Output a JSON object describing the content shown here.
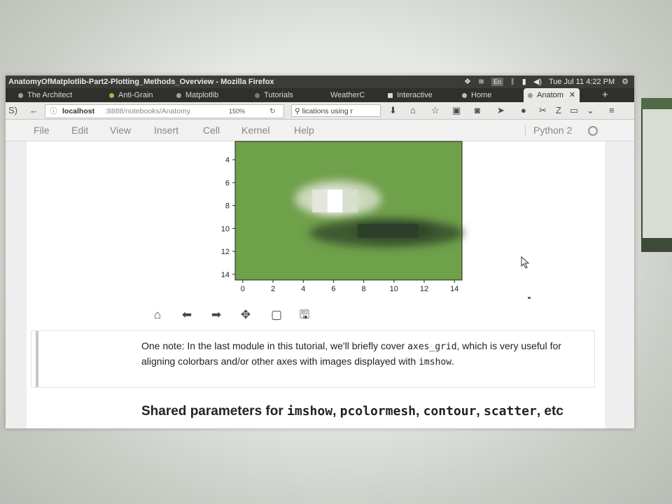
{
  "window": {
    "title": "AnatomyOfMatplotlib-Part2-Plotting_Methods_Overview - Mozilla Firefox",
    "tray_lang": "En",
    "datetime": "Tue Jul 11 4:22 PM"
  },
  "tabs": [
    {
      "label": "The Architect"
    },
    {
      "label": "Anti-Grain"
    },
    {
      "label": "Matplotlib"
    },
    {
      "label": "Tutorials"
    },
    {
      "label": "WeatherC"
    },
    {
      "label": "Interactive"
    },
    {
      "label": "Home"
    },
    {
      "label": "Anatom",
      "active": true
    }
  ],
  "navbar": {
    "url_host": "localhost",
    "url_path": ":8888/notebooks/Anatomy",
    "zoom": "150%",
    "search_value": "lications using r"
  },
  "jupyter_menu": [
    "File",
    "Edit",
    "View",
    "Insert",
    "Cell",
    "Kernel",
    "Help"
  ],
  "kernel": "Python 2",
  "plot": {
    "y_ticks": [
      "4",
      "6",
      "8",
      "10",
      "12",
      "14"
    ],
    "x_ticks": [
      "0",
      "2",
      "4",
      "6",
      "8",
      "10",
      "12",
      "14"
    ],
    "background_color": "#6fa04a"
  },
  "mpl_toolbar": [
    "home-icon",
    "back-arrow-icon",
    "forward-arrow-icon",
    "pan-icon",
    "zoom-rect-icon",
    "save-icon"
  ],
  "markdown": {
    "part1": "One note: In the last module in this tutorial, we'll briefly cover ",
    "code1": "axes_grid",
    "part2": ", which is very useful for aligning colorbars and/or other axes with images displayed with ",
    "code2": "imshow",
    "part3": "."
  },
  "heading": {
    "prefix": "Shared parameters for ",
    "code1": "imshow",
    "sep1": ", ",
    "code2": "pcolormesh",
    "sep2": ", ",
    "code3": "contour",
    "sep3": ", ",
    "code4": "scatter",
    "suffix": ", etc"
  }
}
